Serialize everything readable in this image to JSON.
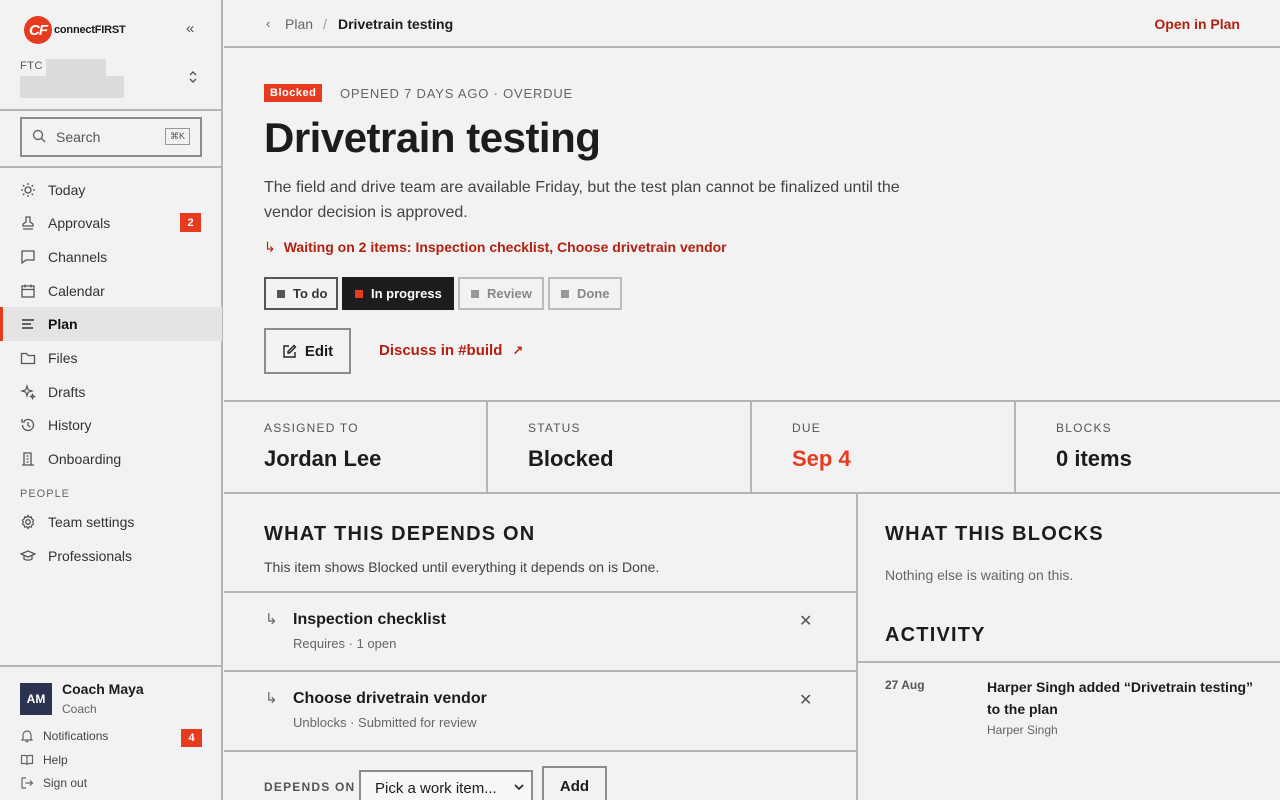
{
  "brand": {
    "logo_mark": "CF",
    "name": "connectFIRST"
  },
  "team": {
    "label": "FTC"
  },
  "search": {
    "placeholder": "Search",
    "shortcut": "⌘K"
  },
  "nav": {
    "items": [
      {
        "label": "Today",
        "icon": "sun-icon"
      },
      {
        "label": "Approvals",
        "icon": "stamp-icon",
        "badge": "2"
      },
      {
        "label": "Channels",
        "icon": "chat-icon"
      },
      {
        "label": "Calendar",
        "icon": "calendar-icon"
      },
      {
        "label": "Plan",
        "icon": "list-icon",
        "active": true
      },
      {
        "label": "Files",
        "icon": "folder-icon"
      },
      {
        "label": "Drafts",
        "icon": "sparkle-icon"
      },
      {
        "label": "History",
        "icon": "history-icon"
      },
      {
        "label": "Onboarding",
        "icon": "building-icon"
      }
    ],
    "people_label": "PEOPLE",
    "people_items": [
      {
        "label": "Team settings",
        "icon": "gear-icon"
      },
      {
        "label": "Professionals",
        "icon": "graduation-icon"
      }
    ]
  },
  "user": {
    "initials": "AM",
    "name": "Coach Maya",
    "role": "Coach",
    "notifications_label": "Notifications",
    "notifications_count": "4",
    "help_label": "Help",
    "signout_label": "Sign out"
  },
  "breadcrumb": {
    "back": "‹",
    "parent": "Plan",
    "sep": "/",
    "current": "Drivetrain testing"
  },
  "open_in_plan": "Open in Plan",
  "item": {
    "status_tag": "Blocked",
    "meta": "OPENED 7 DAYS AGO · OVERDUE",
    "title": "Drivetrain testing",
    "description": "The field and drive team are available Friday, but the test plan cannot be finalized until the vendor decision is approved.",
    "waiting": "Waiting on 2 items: Inspection checklist, Choose drivetrain vendor",
    "states": [
      "To do",
      "In progress",
      "Review",
      "Done"
    ],
    "edit_label": "Edit",
    "discuss_label": "Discuss in #build"
  },
  "stats": [
    {
      "label": "ASSIGNED TO",
      "value": "Jordan Lee"
    },
    {
      "label": "STATUS",
      "value": "Blocked"
    },
    {
      "label": "DUE",
      "value": "Sep 4"
    },
    {
      "label": "BLOCKS",
      "value": "0 items"
    }
  ],
  "depends": {
    "title": "WHAT THIS DEPENDS ON",
    "subtitle": "This item shows Blocked until everything it depends on is Done.",
    "rows": [
      {
        "name": "Inspection checklist",
        "meta": "Requires · 1 open"
      },
      {
        "name": "Choose drivetrain vendor",
        "meta": "Unblocks · Submitted for review"
      }
    ],
    "form_label": "DEPENDS ON",
    "select_value": "Pick a work item...",
    "add_label": "Add"
  },
  "blocks": {
    "title": "WHAT THIS BLOCKS",
    "empty": "Nothing else is waiting on this."
  },
  "activity": {
    "title": "ACTIVITY",
    "entries": [
      {
        "date": "27 Aug",
        "text": "Harper Singh added “Drivetrain testing” to the plan",
        "by": "Harper Singh"
      }
    ]
  },
  "colors": {
    "accent": "#e63b1f",
    "link": "#b3200f",
    "avatar": "#2c3350"
  }
}
